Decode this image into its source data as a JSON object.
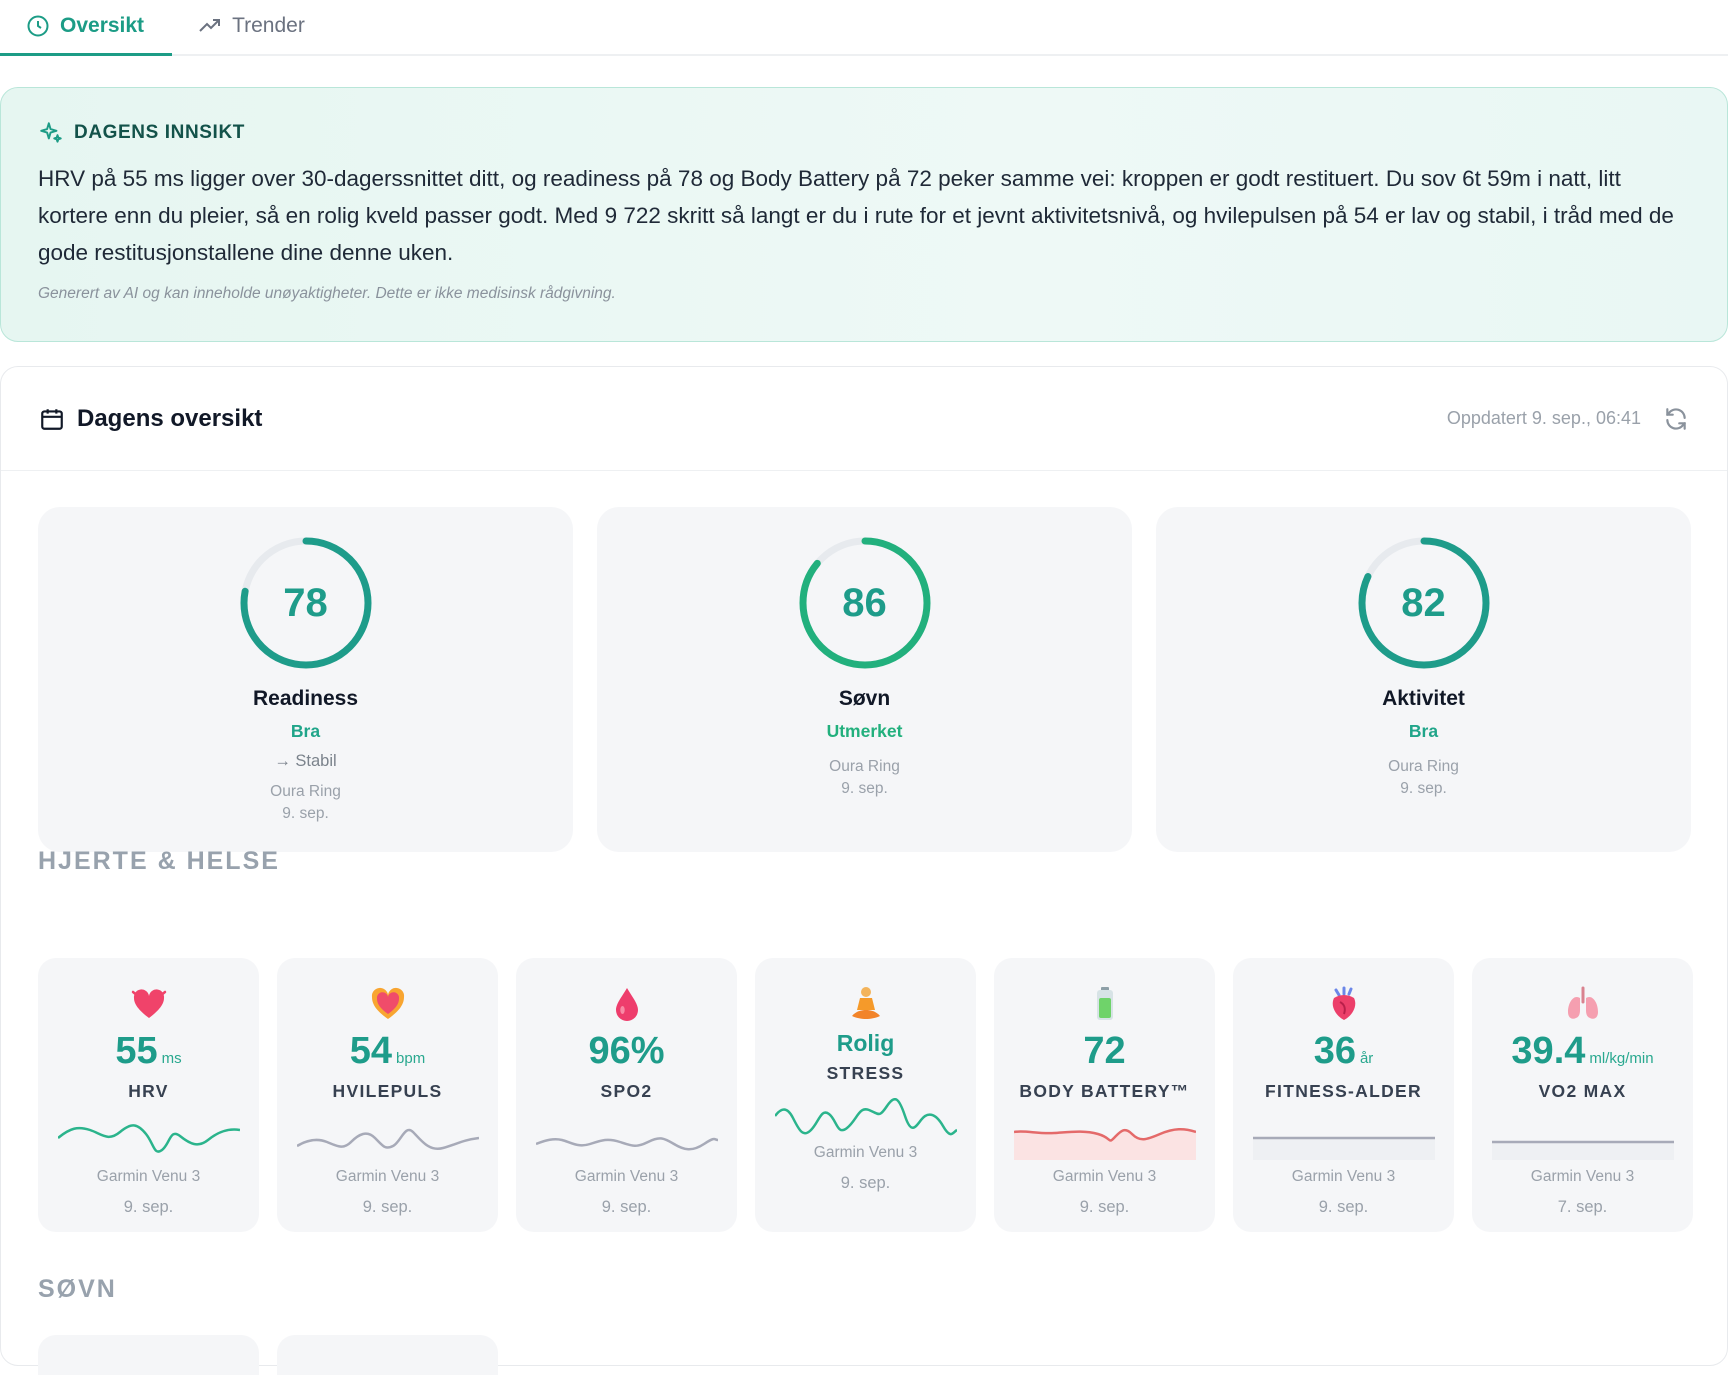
{
  "tabs": [
    {
      "label": "Oversikt",
      "active": true
    },
    {
      "label": "Trender",
      "active": false
    }
  ],
  "insight": {
    "title": "DAGENS INNSIKT",
    "text": "HRV på 55 ms ligger over 30-dagerssnittet ditt, og readiness på 78 og Body Battery på 72 peker samme vei: kroppen er godt restituert. Du sov 6t 59m i natt, litt kortere enn du pleier, så en rolig kveld passer godt. Med 9 722 skritt så langt er du i rute for et jevnt aktivitetsnivå, og hvilepulsen på 54 er lav og stabil, i tråd med de gode restitusjonstallene dine denne uken.",
    "note": "Generert av AI og kan inneholde unøyaktigheter. Dette er ikke medisinsk rådgivning."
  },
  "overview": {
    "title": "Dagens oversikt",
    "updated": "Oppdatert 9. sep., 06:41"
  },
  "scores": [
    {
      "value": "78",
      "score": 78,
      "label": "Readiness",
      "rating": "Bra",
      "trend": "→ Stabil",
      "source": "Oura Ring",
      "date": "9. sep."
    },
    {
      "value": "86",
      "score": 86,
      "label": "Søvn",
      "rating": "Utmerket",
      "source": "Oura Ring",
      "date": "9. sep."
    },
    {
      "value": "82",
      "score": 82,
      "label": "Aktivitet",
      "rating": "Bra",
      "source": "Oura Ring",
      "date": "9. sep."
    }
  ],
  "sections": {
    "heart": "HJERTE & HELSE",
    "sleep": "SØVN"
  },
  "metrics": [
    {
      "icon": "heart-ribbon-icon",
      "value": "55",
      "unit": "ms",
      "name": "HRV",
      "source": "Garmin Venu 3",
      "date": "9. sep.",
      "color": "#2bb48c"
    },
    {
      "icon": "heart-glow-icon",
      "value": "54",
      "unit": "bpm",
      "name": "HVILEPULS",
      "source": "Garmin Venu 3",
      "date": "9. sep.",
      "color": "#a7aab8"
    },
    {
      "icon": "drop-icon",
      "value": "96%",
      "unit": "",
      "name": "SPO2",
      "source": "Garmin Venu 3",
      "date": "9. sep.",
      "color": "#a7aab8"
    },
    {
      "icon": "meditation-icon",
      "word": "Rolig",
      "name": "STRESS",
      "source": "Garmin Venu 3",
      "date": "9. sep.",
      "color": "#2bb48c"
    },
    {
      "icon": "battery-icon",
      "value": "72",
      "unit": "",
      "name": "BODY BATTERY™",
      "source": "Garmin Venu 3",
      "date": "9. sep.",
      "color": "#e46a6a"
    },
    {
      "icon": "anatomical-heart-icon",
      "value": "36",
      "unit": "år",
      "name": "FITNESS-ALDER",
      "source": "Garmin Venu 3",
      "date": "9. sep.",
      "color": "#a7aab8"
    },
    {
      "icon": "lungs-icon",
      "value": "39.4",
      "unit": "ml/kg/min",
      "name": "VO2 MAX",
      "source": "Garmin Venu 3",
      "date": "7. sep.",
      "color": "#a7aab8"
    }
  ],
  "colors": {
    "accent": "#1e9c8a",
    "good": "#20a58a",
    "excellent": "#22b07d"
  }
}
